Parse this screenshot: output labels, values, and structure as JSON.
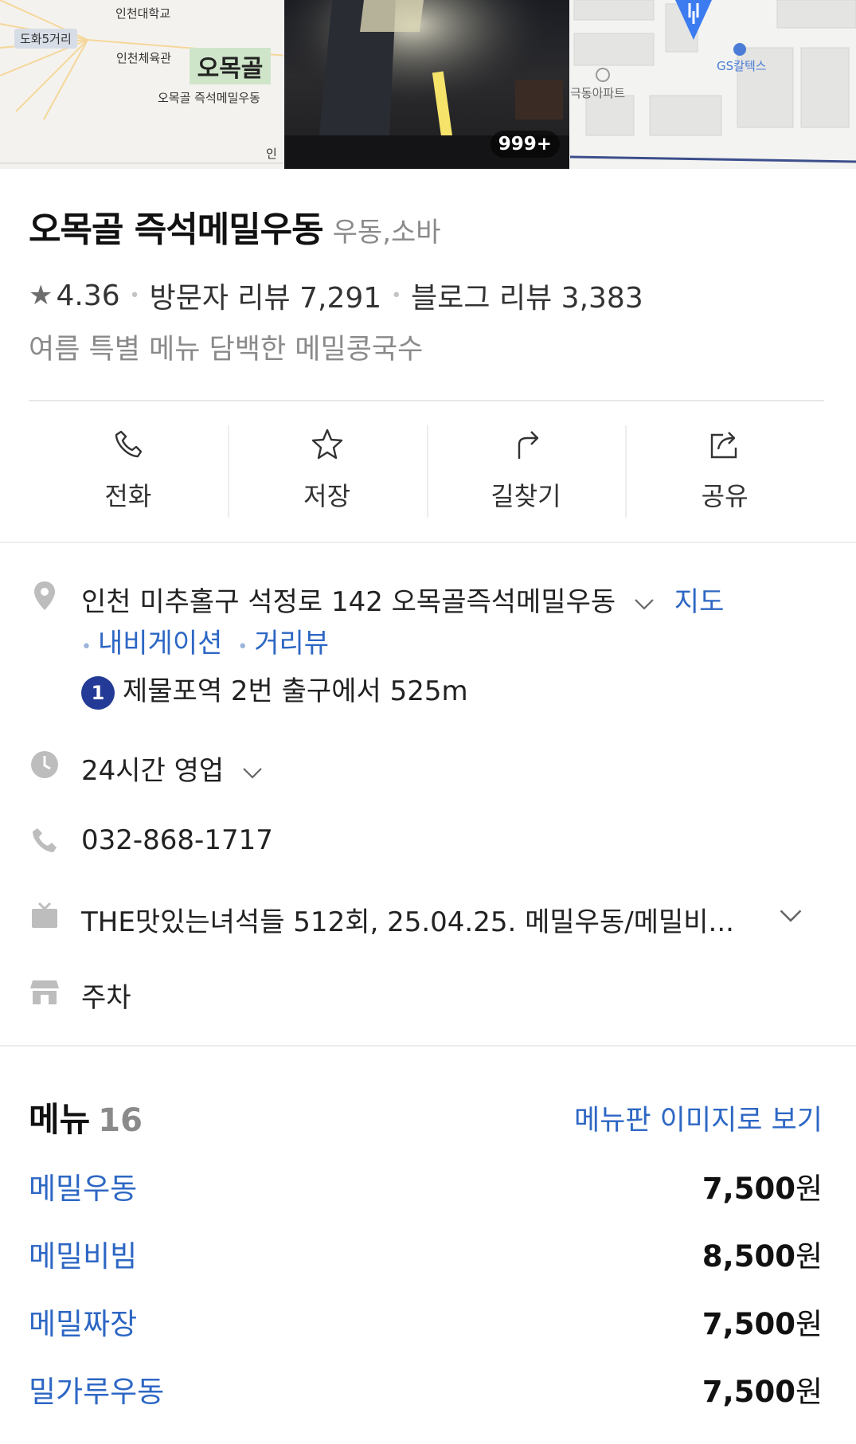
{
  "images": {
    "map1": {
      "labels": [
        "인천대학교",
        "도화5거리",
        "인천체육관",
        "오목골 즉석메밀우동",
        "인"
      ],
      "logo_text": "오목골"
    },
    "photo": {
      "count_badge": "999+"
    },
    "map2": {
      "labels": [
        "GS칼텍스",
        "극동아파트"
      ]
    }
  },
  "place": {
    "name": "오목골 즉석메밀우동",
    "category": "우동,소바",
    "rating": "4.36",
    "visitor_reviews": "방문자 리뷰 7,291",
    "blog_reviews": "블로그 리뷰 3,383",
    "tagline": "여름 특별 메뉴 담백한 메밀콩국수"
  },
  "actions": [
    {
      "label": "전화",
      "icon": "phone-icon"
    },
    {
      "label": "저장",
      "icon": "star-icon"
    },
    {
      "label": "길찾기",
      "icon": "directions-icon"
    },
    {
      "label": "공유",
      "icon": "share-icon"
    }
  ],
  "info": {
    "address": "인천 미추홀구 석정로 142 오목골즉석메밀우동",
    "map_link": "지도",
    "navigation_link": "내비게이션",
    "streetview_link": "거리뷰",
    "subway_line": "1",
    "subway_text": "제물포역 2번 출구에서 525m",
    "hours": "24시간 영업",
    "phone": "032-868-1717",
    "tv": "THE맛있는녀석들 512회, 25.04.25. 메밀우동/메밀비...",
    "parking": "주차"
  },
  "menu": {
    "title": "메뉴",
    "count": "16",
    "board_link": "메뉴판 이미지로 보기",
    "items": [
      {
        "name": "메밀우동",
        "price": "7,500",
        "unit": "원"
      },
      {
        "name": "메밀비빔",
        "price": "8,500",
        "unit": "원"
      },
      {
        "name": "메밀짜장",
        "price": "7,500",
        "unit": "원"
      },
      {
        "name": "밀가루우동",
        "price": "7,500",
        "unit": "원"
      }
    ]
  },
  "colors": {
    "link": "#2d67c4",
    "subway_line1": "#233b96",
    "muted": "#8a8a8a"
  }
}
